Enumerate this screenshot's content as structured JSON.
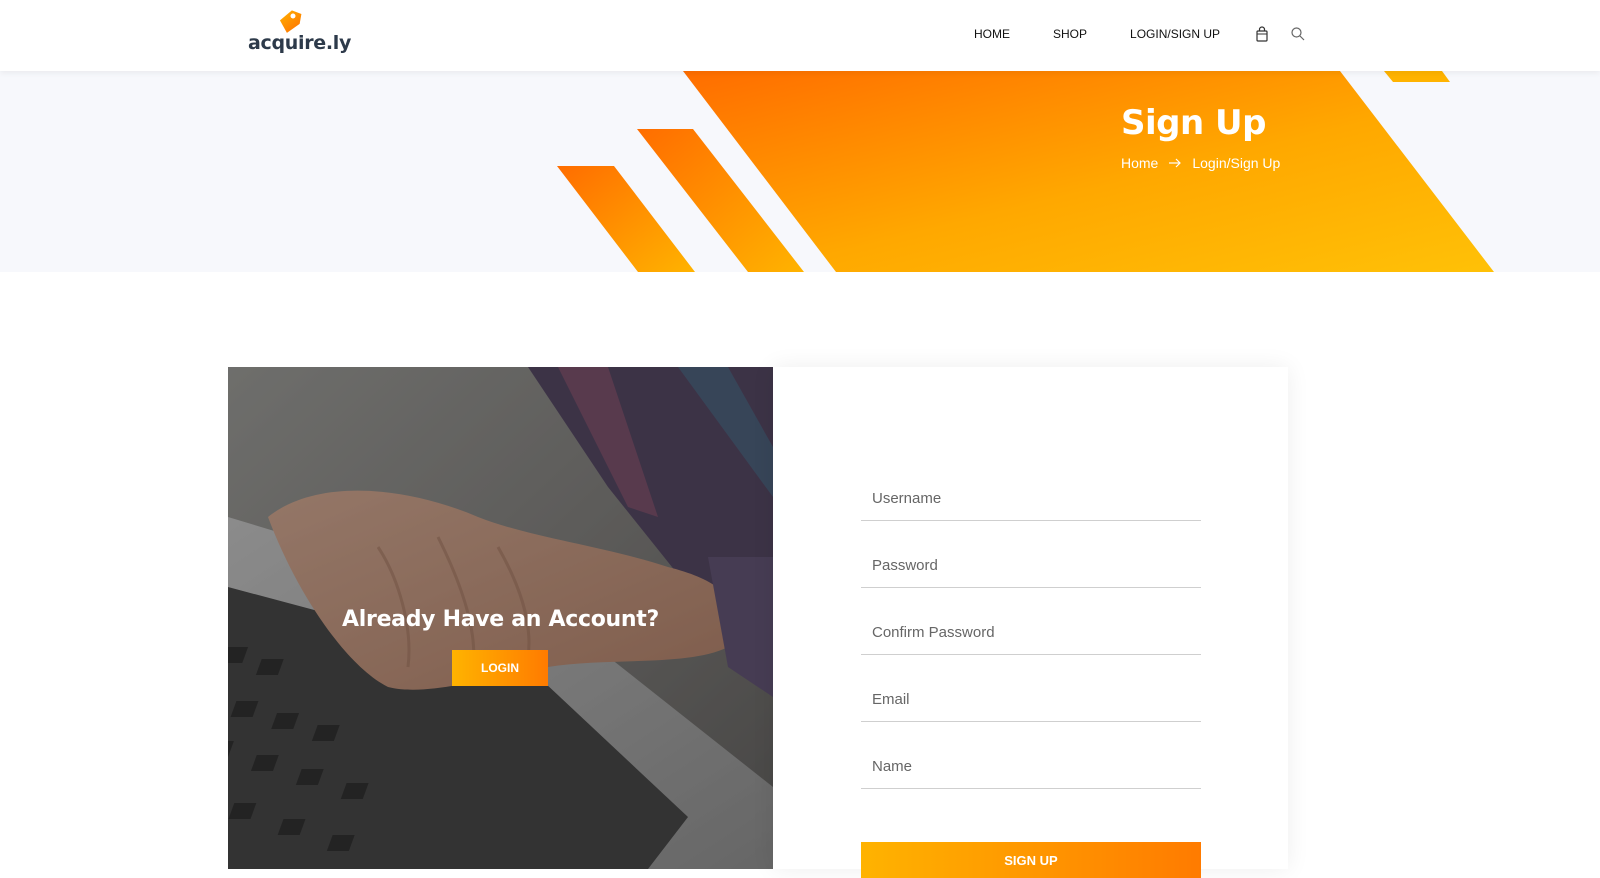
{
  "header": {
    "logo_text": "acquire.ly",
    "nav": [
      "HOME",
      "SHOP",
      "LOGIN/SIGN UP"
    ],
    "icons": [
      "shopping-bag-icon",
      "search-icon"
    ]
  },
  "hero": {
    "title": "Sign Up",
    "breadcrumb": [
      "Home",
      "Login/Sign Up"
    ]
  },
  "login_panel": {
    "heading": "Already Have an Account?",
    "button_label": "LOGIN"
  },
  "signup_form": {
    "placeholders": [
      "Username",
      "Password",
      "Confirm Password",
      "Email",
      "Name"
    ],
    "button_label": "SIGN UP"
  },
  "colors": {
    "accent_start": "#ffb300",
    "accent_end": "#ff7b00",
    "hero_bg": "#f7f8fc"
  }
}
